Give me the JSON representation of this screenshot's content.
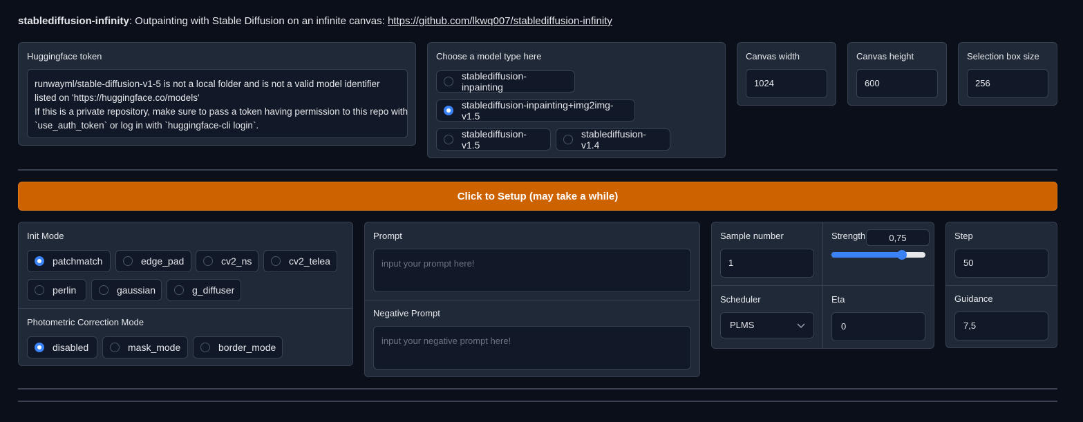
{
  "header": {
    "app_name": "stablediffusion-infinity",
    "description": ": Outpainting with Stable Diffusion on an infinite canvas: ",
    "link": "https://github.com/lkwq007/stablediffusion-infinity"
  },
  "token": {
    "label": "Huggingface token",
    "value_line1": "runwayml/stable-diffusion-v1-5 is not a local folder and is not a valid model identifier",
    "value_line2": "listed on 'https://huggingface.co/models'",
    "value_line3": "If this is a private repository, make sure to pass a token having permission to this repo with",
    "value_line4": "`use_auth_token` or log in with `huggingface-cli login`."
  },
  "model": {
    "label": "Choose a model type here",
    "options": [
      "stablediffusion-inpainting",
      "stablediffusion-inpainting+img2img-v1.5",
      "stablediffusion-v1.5",
      "stablediffusion-v1.4"
    ],
    "selected": "stablediffusion-inpainting+img2img-v1.5"
  },
  "canvas_width": {
    "label": "Canvas width",
    "value": "1024"
  },
  "canvas_height": {
    "label": "Canvas height",
    "value": "600"
  },
  "selection_box": {
    "label": "Selection box size",
    "value": "256"
  },
  "setup_button": {
    "label": "Click to Setup (may take a while)",
    "color": "#cc6200"
  },
  "init_mode": {
    "label": "Init Mode",
    "options": [
      "patchmatch",
      "edge_pad",
      "cv2_ns",
      "cv2_telea",
      "perlin",
      "gaussian",
      "g_diffuser"
    ],
    "selected": "patchmatch"
  },
  "photometric": {
    "label": "Photometric Correction Mode",
    "options": [
      "disabled",
      "mask_mode",
      "border_mode"
    ],
    "selected": "disabled"
  },
  "prompt": {
    "label": "Prompt",
    "placeholder": "input your prompt here!"
  },
  "negative_prompt": {
    "label": "Negative Prompt",
    "placeholder": "input your negative prompt here!"
  },
  "sample_number": {
    "label": "Sample number",
    "value": "1"
  },
  "strength": {
    "label": "Strength",
    "value": "0,75",
    "fraction": 0.75
  },
  "step": {
    "label": "Step",
    "value": "50"
  },
  "scheduler": {
    "label": "Scheduler",
    "value": "PLMS"
  },
  "eta": {
    "label": "Eta",
    "value": "0"
  },
  "guidance": {
    "label": "Guidance",
    "value": "7,5"
  },
  "colors": {
    "accent": "#3b82f6",
    "background": "#0b0f19",
    "panel": "#1f2937"
  }
}
